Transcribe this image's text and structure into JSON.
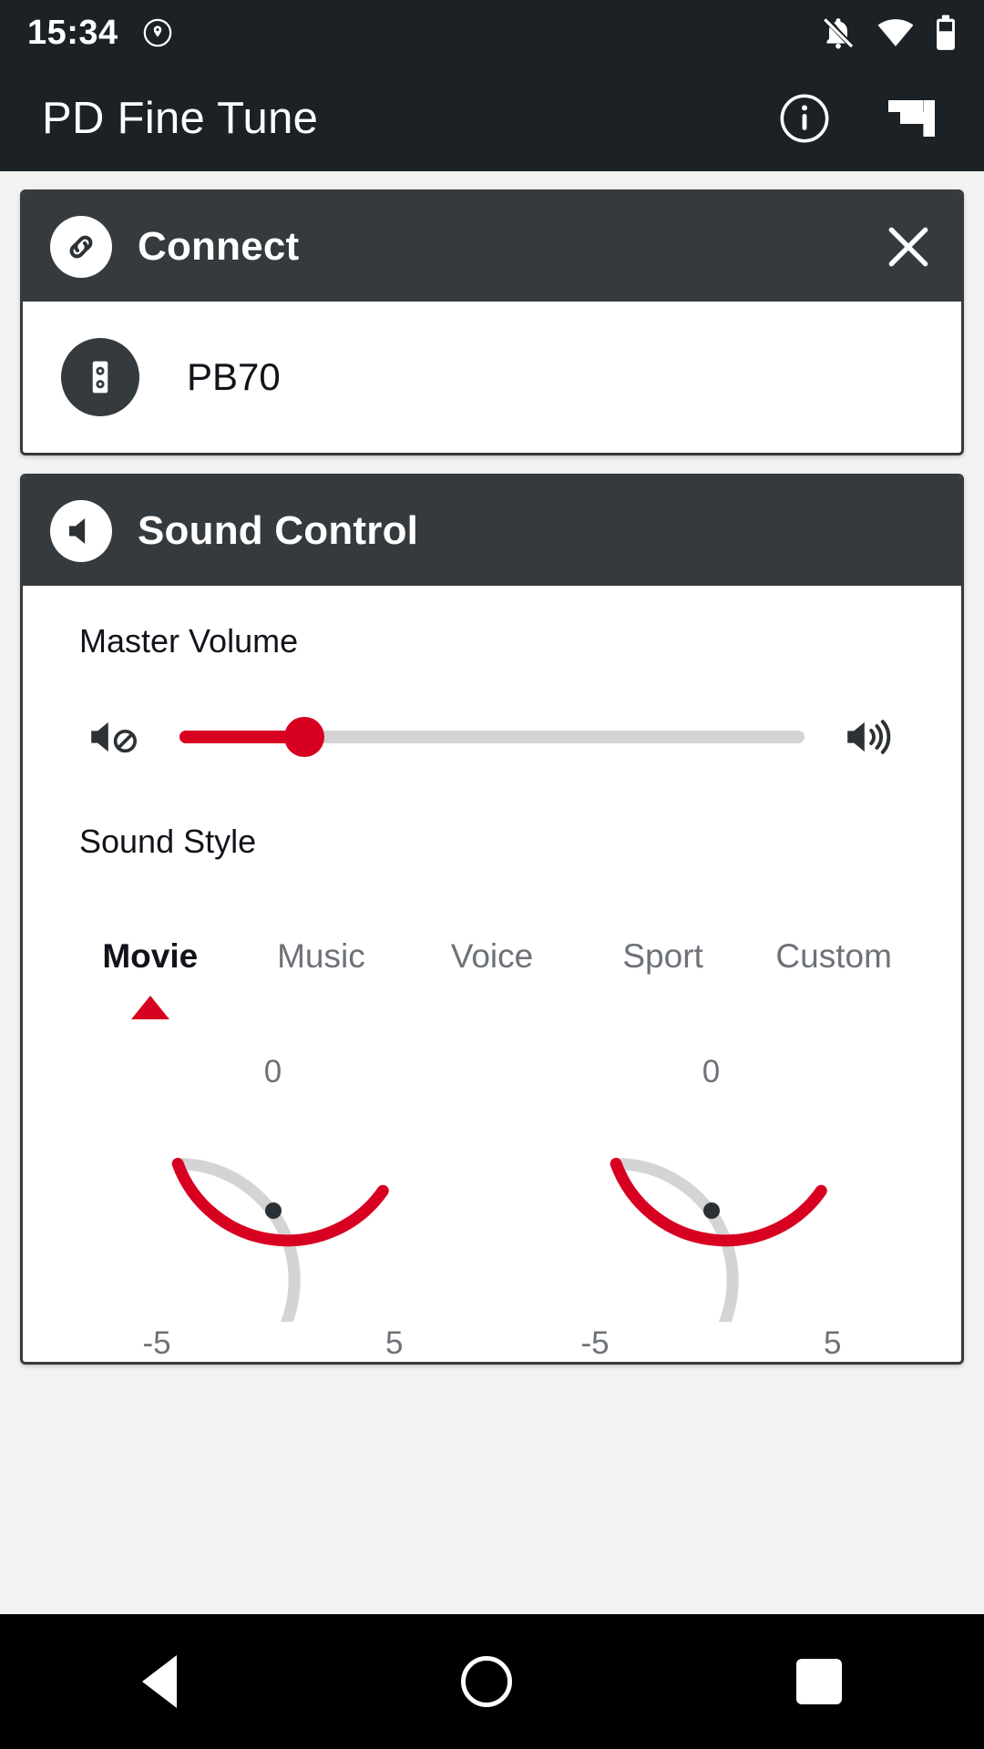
{
  "statusbar": {
    "time": "15:34",
    "icons": [
      "location-shield-icon",
      "notifications-off-icon",
      "wifi-icon",
      "battery-icon"
    ]
  },
  "appbar": {
    "title": "PD Fine Tune",
    "info_icon": "info-icon",
    "flag_icon": "flag-icon"
  },
  "connect_card": {
    "title": "Connect",
    "icon": "link-icon",
    "close_icon": "close-icon",
    "device": {
      "name": "PB70",
      "icon": "speaker-icon"
    }
  },
  "sound_control_card": {
    "title": "Sound Control",
    "icon": "volume-icon",
    "master_volume": {
      "label": "Master Volume",
      "mute_icon": "volume-mute-icon",
      "max_icon": "volume-up-icon",
      "value_percent": 20
    },
    "sound_style": {
      "label": "Sound Style",
      "tabs": [
        {
          "label": "Movie",
          "active": true
        },
        {
          "label": "Music",
          "active": false
        },
        {
          "label": "Voice",
          "active": false
        },
        {
          "label": "Sport",
          "active": false
        },
        {
          "label": "Custom",
          "active": false
        }
      ],
      "indicator_icon": "triangle-up-indicator-icon"
    },
    "gauges": [
      {
        "value": "0",
        "min_label": "-5",
        "max_label": "5",
        "fill_ratio": 0.5
      },
      {
        "value": "0",
        "min_label": "-5",
        "max_label": "5",
        "fill_ratio": 0.5
      }
    ]
  },
  "navbar": {
    "back": "back-nav-button",
    "home": "home-nav-button",
    "recent": "recents-nav-button"
  },
  "colors": {
    "accent_red": "#d80020",
    "dark": "#343a3d",
    "statusbar": "#1b2124",
    "track_gray": "#d4d4d4",
    "muted_text": "#6d7278"
  }
}
